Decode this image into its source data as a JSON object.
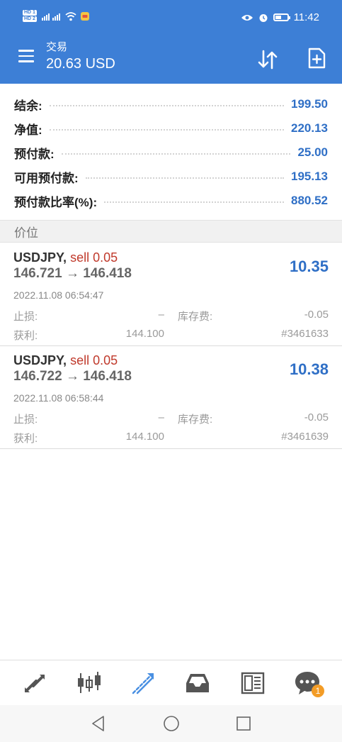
{
  "status_bar": {
    "network_badges": [
      "HD 1",
      "HD 2"
    ],
    "signal_text": "4G",
    "time": "11:42"
  },
  "app_bar": {
    "title": "交易",
    "subtitle": "20.63 USD"
  },
  "summary": [
    {
      "label": "结余:",
      "value": "199.50"
    },
    {
      "label": "净值:",
      "value": "220.13"
    },
    {
      "label": "预付款:",
      "value": "25.00"
    },
    {
      "label": "可用预付款:",
      "value": "195.13"
    },
    {
      "label": "预付款比率(%):",
      "value": "880.52"
    }
  ],
  "section_header": "价位",
  "positions": [
    {
      "symbol": "USDJPY,",
      "side": "sell 0.05",
      "prices": "146.721 → 146.418",
      "profit": "10.35",
      "time": "2022.11.08 06:54:47",
      "sl_label": "止损:",
      "sl_value": "–",
      "swap_label": "库存费:",
      "swap_value": "-0.05",
      "tp_label": "获利:",
      "tp_value": "144.100",
      "ticket": "#3461633"
    },
    {
      "symbol": "USDJPY,",
      "side": "sell 0.05",
      "prices": "146.722 → 146.418",
      "profit": "10.38",
      "time": "2022.11.08 06:58:44",
      "sl_label": "止损:",
      "sl_value": "–",
      "swap_label": "库存费:",
      "swap_value": "-0.05",
      "tp_label": "获利:",
      "tp_value": "144.100",
      "ticket": "#3461639"
    }
  ],
  "bottom_nav": {
    "items": [
      "quotes-icon",
      "chart-icon",
      "trade-icon",
      "history-icon",
      "news-icon",
      "chat-icon"
    ],
    "active": "trade-icon",
    "chat_badge": "1"
  },
  "colors": {
    "brand": "#3d7fd6",
    "value_blue": "#2f6fc6",
    "sell_red": "#c0392b"
  }
}
